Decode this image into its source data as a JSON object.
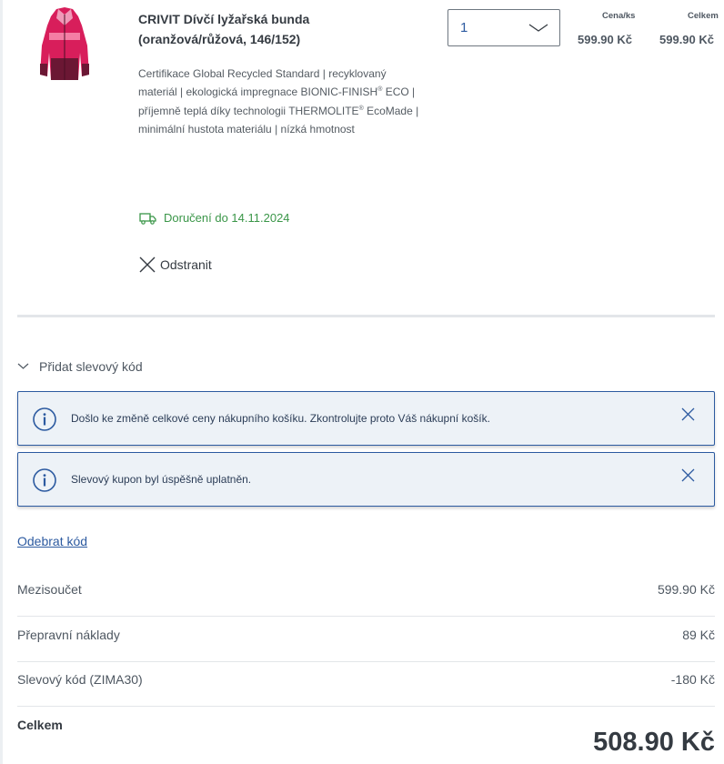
{
  "product": {
    "title": "CRIVIT Dívčí lyžařská bunda (oranžová/růžová, 146/152)",
    "description_parts": [
      "Certifikace Global Recycled Standard | recyklovaný materiál | ekologická impregnace BIONIC-FINISH",
      "®",
      " ECO | příjemně teplá díky technologii THERMOLITE",
      "®",
      " EcoMade | minimální hustota materiálu | nízká hmotnost"
    ],
    "image_icon": "ski-jacket-image",
    "colors": {
      "jacket_main": "#d81e5b",
      "jacket_dark": "#6b1734",
      "jacket_light": "#f09ab8"
    }
  },
  "quantity": {
    "value": "1",
    "icon": "chevron-down-icon"
  },
  "prices": {
    "unit_label": "Cena/ks",
    "unit_value": "599.90 Kč",
    "total_label": "Celkem",
    "total_value": "599.90 Kč"
  },
  "delivery": {
    "icon": "truck-icon",
    "text": "Doručení do 14.11.2024",
    "color": "#3a9648"
  },
  "remove": {
    "icon": "close-icon",
    "label": "Odstranit"
  },
  "coupon": {
    "icon": "chevron-down-icon",
    "toggle_label": "Přidat slevový kód"
  },
  "alerts": [
    {
      "icon": "info-icon",
      "text": "Došlo ke změně celkové ceny nákupního košíku. Zkontrolujte proto Váš nákupní košík.",
      "close_icon": "close-icon"
    },
    {
      "icon": "info-icon",
      "text": "Slevový kupon byl úspěšně uplatněn.",
      "close_icon": "close-icon"
    }
  ],
  "remove_code_label": "Odebrat kód",
  "summary": {
    "rows": [
      {
        "label": "Mezisoučet",
        "value": "599.90 Kč"
      },
      {
        "label": "Přepravní náklady",
        "value": "89 Kč"
      },
      {
        "label": "Slevový kód (ZIMA30)",
        "value": "-180 Kč"
      }
    ],
    "total_label": "Celkem",
    "total_value": "508.90 Kč"
  },
  "colors": {
    "accent": "#2c5aa0",
    "alert_bg": "#edf2f7",
    "text": "#353b42"
  }
}
